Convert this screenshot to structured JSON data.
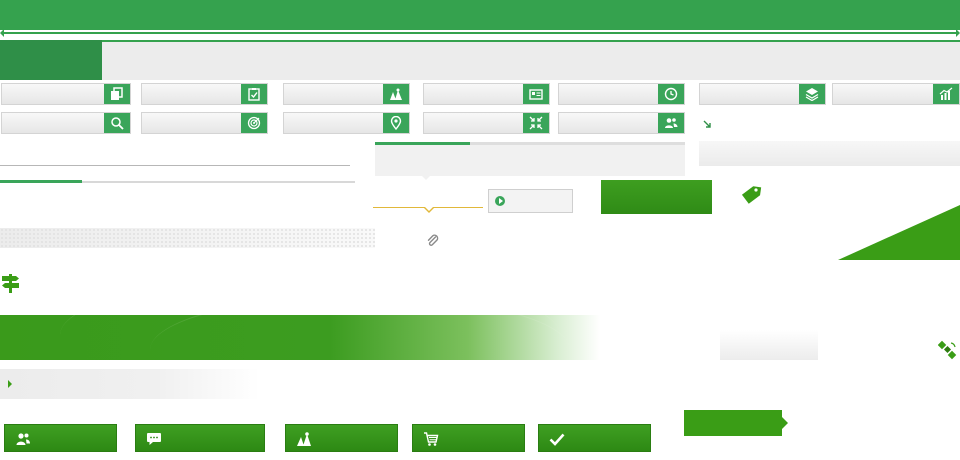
{
  "colors": {
    "brand_green": "#35a24e",
    "tile_icon_green": "#3aa55a",
    "button_green": "#3a9d16",
    "accent_gold": "#e1b83a"
  },
  "tiles_row1": [
    {
      "icon": "copy-icon"
    },
    {
      "icon": "clipboard-check-icon"
    },
    {
      "icon": "map-icon"
    },
    {
      "icon": "id-card-icon"
    },
    {
      "icon": "clock-icon"
    },
    {
      "icon": "layers-icon"
    },
    {
      "icon": "chart-icon"
    }
  ],
  "tiles_row2": [
    {
      "icon": "search-icon"
    },
    {
      "icon": "target-icon"
    },
    {
      "icon": "map-pin-icon"
    },
    {
      "icon": "collapse-icon"
    },
    {
      "icon": "users-icon"
    }
  ],
  "misc_icons": [
    "resize-arrow-icon",
    "paperclip-icon",
    "tag-icon",
    "signpost-icon",
    "satellite-icon",
    "play-icon"
  ],
  "progress": {
    "percent": 23
  },
  "buttons": [
    {
      "icon": "users-icon"
    },
    {
      "icon": "chat-icon"
    },
    {
      "icon": "map-icon"
    },
    {
      "icon": "cart-icon"
    },
    {
      "icon": "check-icon"
    }
  ]
}
